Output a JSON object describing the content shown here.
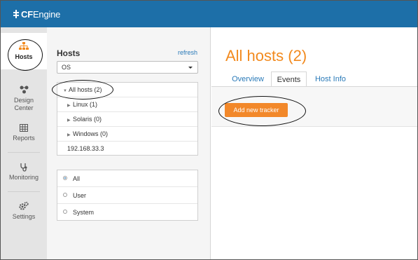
{
  "brand": {
    "cf": "CF",
    "engine": "Engine",
    "accent": "#1d6fa8"
  },
  "leftnav": {
    "items": [
      {
        "label": "Hosts",
        "icon": "hosts-icon"
      },
      {
        "label": "Design Center",
        "icon": "design-center-icon"
      },
      {
        "label": "Reports",
        "icon": "reports-icon"
      },
      {
        "label": "Monitoring",
        "icon": "monitoring-icon"
      },
      {
        "label": "Settings",
        "icon": "settings-icon"
      }
    ]
  },
  "hosts_panel": {
    "title": "Hosts",
    "refresh": "refresh",
    "select_value": "OS",
    "tree": [
      {
        "label": "All hosts (2)",
        "expanded": true
      },
      {
        "label": "Linux (1)"
      },
      {
        "label": "Solaris (0)"
      },
      {
        "label": "Windows (0)"
      },
      {
        "label": "192.168.33.3"
      }
    ],
    "filters": [
      {
        "label": "All",
        "selected": true
      },
      {
        "label": "User",
        "selected": false
      },
      {
        "label": "System",
        "selected": false
      }
    ]
  },
  "main": {
    "title": "All hosts (2)",
    "tabs": [
      {
        "label": "Overview",
        "active": false
      },
      {
        "label": "Events",
        "active": true
      },
      {
        "label": "Host Info",
        "active": false
      }
    ],
    "add_tracker_label": "Add new tracker",
    "title_color": "#f28a1e",
    "button_color": "#f2882a"
  }
}
